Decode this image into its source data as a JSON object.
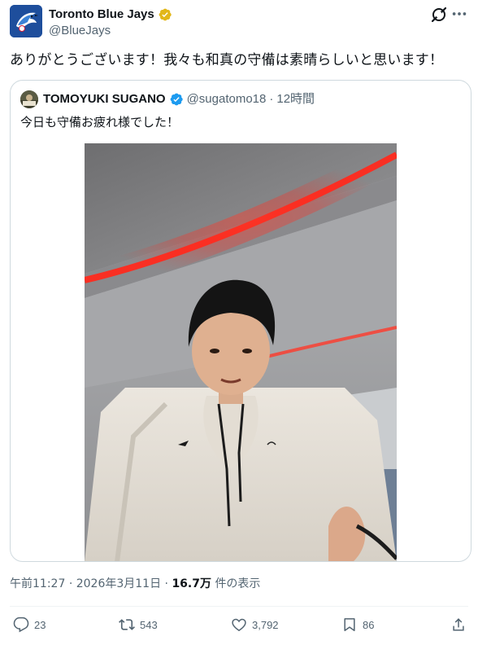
{
  "author": {
    "display_name": "Toronto Blue Jays",
    "handle": "@BlueJays",
    "verified_badge": "gold-check-icon"
  },
  "tweet": {
    "text": "ありがとうございます！我々も和真の守備は素晴らしいと思います！"
  },
  "quoted_tweet": {
    "display_name": "TOMOYUKI SUGANO",
    "handle": "@sugatomo18",
    "separator": "·",
    "time": "12時間",
    "text": "今日も守備お疲れ様でした！",
    "verified_badge": "blue-check-icon"
  },
  "meta": {
    "time": "午前11:27",
    "separator": "·",
    "date": "2026年3月11日",
    "separator2": "·",
    "views_count": "16.7万",
    "views_label": "件の表示"
  },
  "actions": {
    "replies": "23",
    "reposts": "543",
    "likes": "3,792",
    "bookmarks": "86"
  },
  "colors": {
    "text_primary": "#0f1419",
    "text_secondary": "#536471",
    "border": "#cfd9de",
    "verified_blue": "#1d9bf0",
    "verified_gold": "#e2b719"
  }
}
